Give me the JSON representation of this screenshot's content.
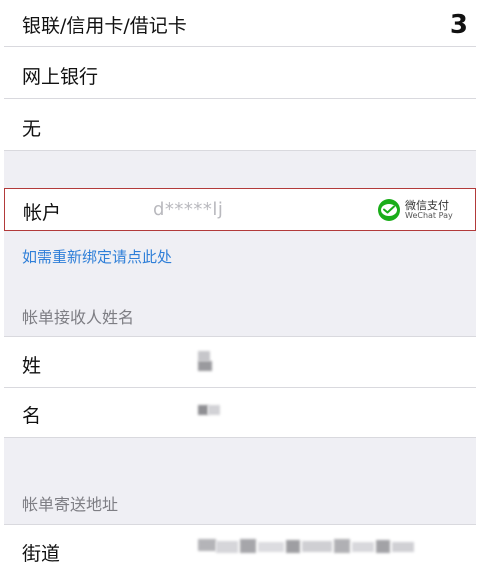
{
  "payment": {
    "selected_label": "银联/信用卡/借记卡",
    "count": "3",
    "options": [
      {
        "label": "网上银行"
      },
      {
        "label": "无"
      }
    ]
  },
  "account": {
    "label": "帐户",
    "masked_value": "d*****lj",
    "provider_cn": "微信支付",
    "provider_en": "WeChat Pay",
    "highlight_color": "#b23a3a",
    "rebind_link": "如需重新绑定请点此处",
    "link_color": "#2f7fd8"
  },
  "billing_recipient": {
    "header": "帐单接收人姓名",
    "last_name_label": "姓",
    "first_name_label": "名"
  },
  "billing_address": {
    "header": "帐单寄送地址",
    "street_label": "街道"
  }
}
